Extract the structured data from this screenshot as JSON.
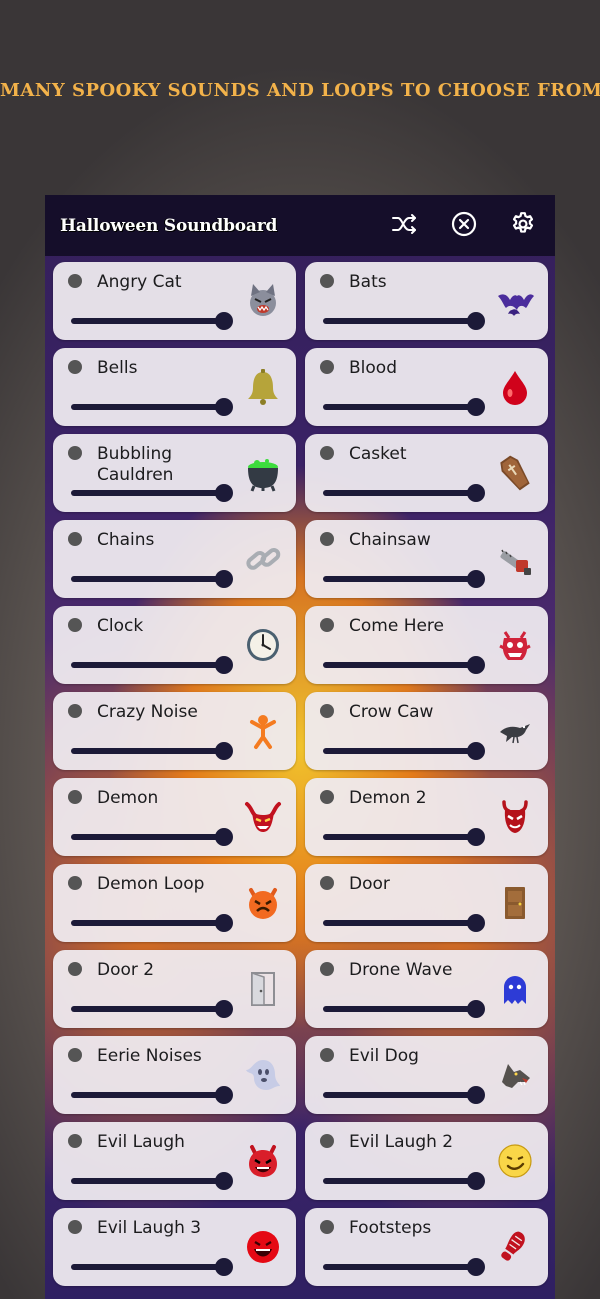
{
  "promo": {
    "text": "MANY SPOOKY SOUNDS AND LOOPS TO CHOOSE FROM",
    "color": "#f2b24a"
  },
  "app": {
    "title": "Halloween Soundboard",
    "toolbar": {
      "shuffle_icon": "shuffle-icon",
      "stop_all_icon": "close-circle-icon",
      "settings_icon": "gear-icon"
    }
  },
  "sounds": [
    {
      "label": "Angry Cat",
      "icon": "angry-cat-icon",
      "volume": 1.0
    },
    {
      "label": "Bats",
      "icon": "bat-icon",
      "volume": 1.0
    },
    {
      "label": "Bells",
      "icon": "bell-icon",
      "volume": 1.0
    },
    {
      "label": "Blood",
      "icon": "blood-drop-icon",
      "volume": 1.0
    },
    {
      "label": "Bubbling Cauldren",
      "icon": "cauldron-icon",
      "volume": 1.0
    },
    {
      "label": "Casket",
      "icon": "coffin-icon",
      "volume": 1.0
    },
    {
      "label": "Chains",
      "icon": "chain-icon",
      "volume": 1.0
    },
    {
      "label": "Chainsaw",
      "icon": "chainsaw-icon",
      "volume": 1.0
    },
    {
      "label": "Clock",
      "icon": "clock-icon",
      "volume": 1.0
    },
    {
      "label": "Come Here",
      "icon": "monster-icon",
      "volume": 1.0
    },
    {
      "label": "Crazy Noise",
      "icon": "crazy-person-icon",
      "volume": 1.0
    },
    {
      "label": "Crow Caw",
      "icon": "crow-icon",
      "volume": 1.0
    },
    {
      "label": "Demon",
      "icon": "demon-face-icon",
      "volume": 1.0
    },
    {
      "label": "Demon 2",
      "icon": "devil-mask-icon",
      "volume": 1.0
    },
    {
      "label": "Demon Loop",
      "icon": "angry-devil-icon",
      "volume": 1.0
    },
    {
      "label": "Door",
      "icon": "door-icon",
      "volume": 1.0
    },
    {
      "label": "Door 2",
      "icon": "open-door-icon",
      "volume": 1.0
    },
    {
      "label": "Drone Wave",
      "icon": "ghost-icon",
      "volume": 1.0
    },
    {
      "label": "Eerie Noises",
      "icon": "spirit-icon",
      "volume": 1.0
    },
    {
      "label": "Evil Dog",
      "icon": "wolf-icon",
      "volume": 1.0
    },
    {
      "label": "Evil Laugh",
      "icon": "laughing-devil-icon",
      "volume": 1.0
    },
    {
      "label": "Evil Laugh 2",
      "icon": "smirk-face-icon",
      "volume": 1.0
    },
    {
      "label": "Evil Laugh 3",
      "icon": "red-grin-icon",
      "volume": 1.0
    },
    {
      "label": "Footsteps",
      "icon": "shoe-print-icon",
      "volume": 1.0
    }
  ]
}
